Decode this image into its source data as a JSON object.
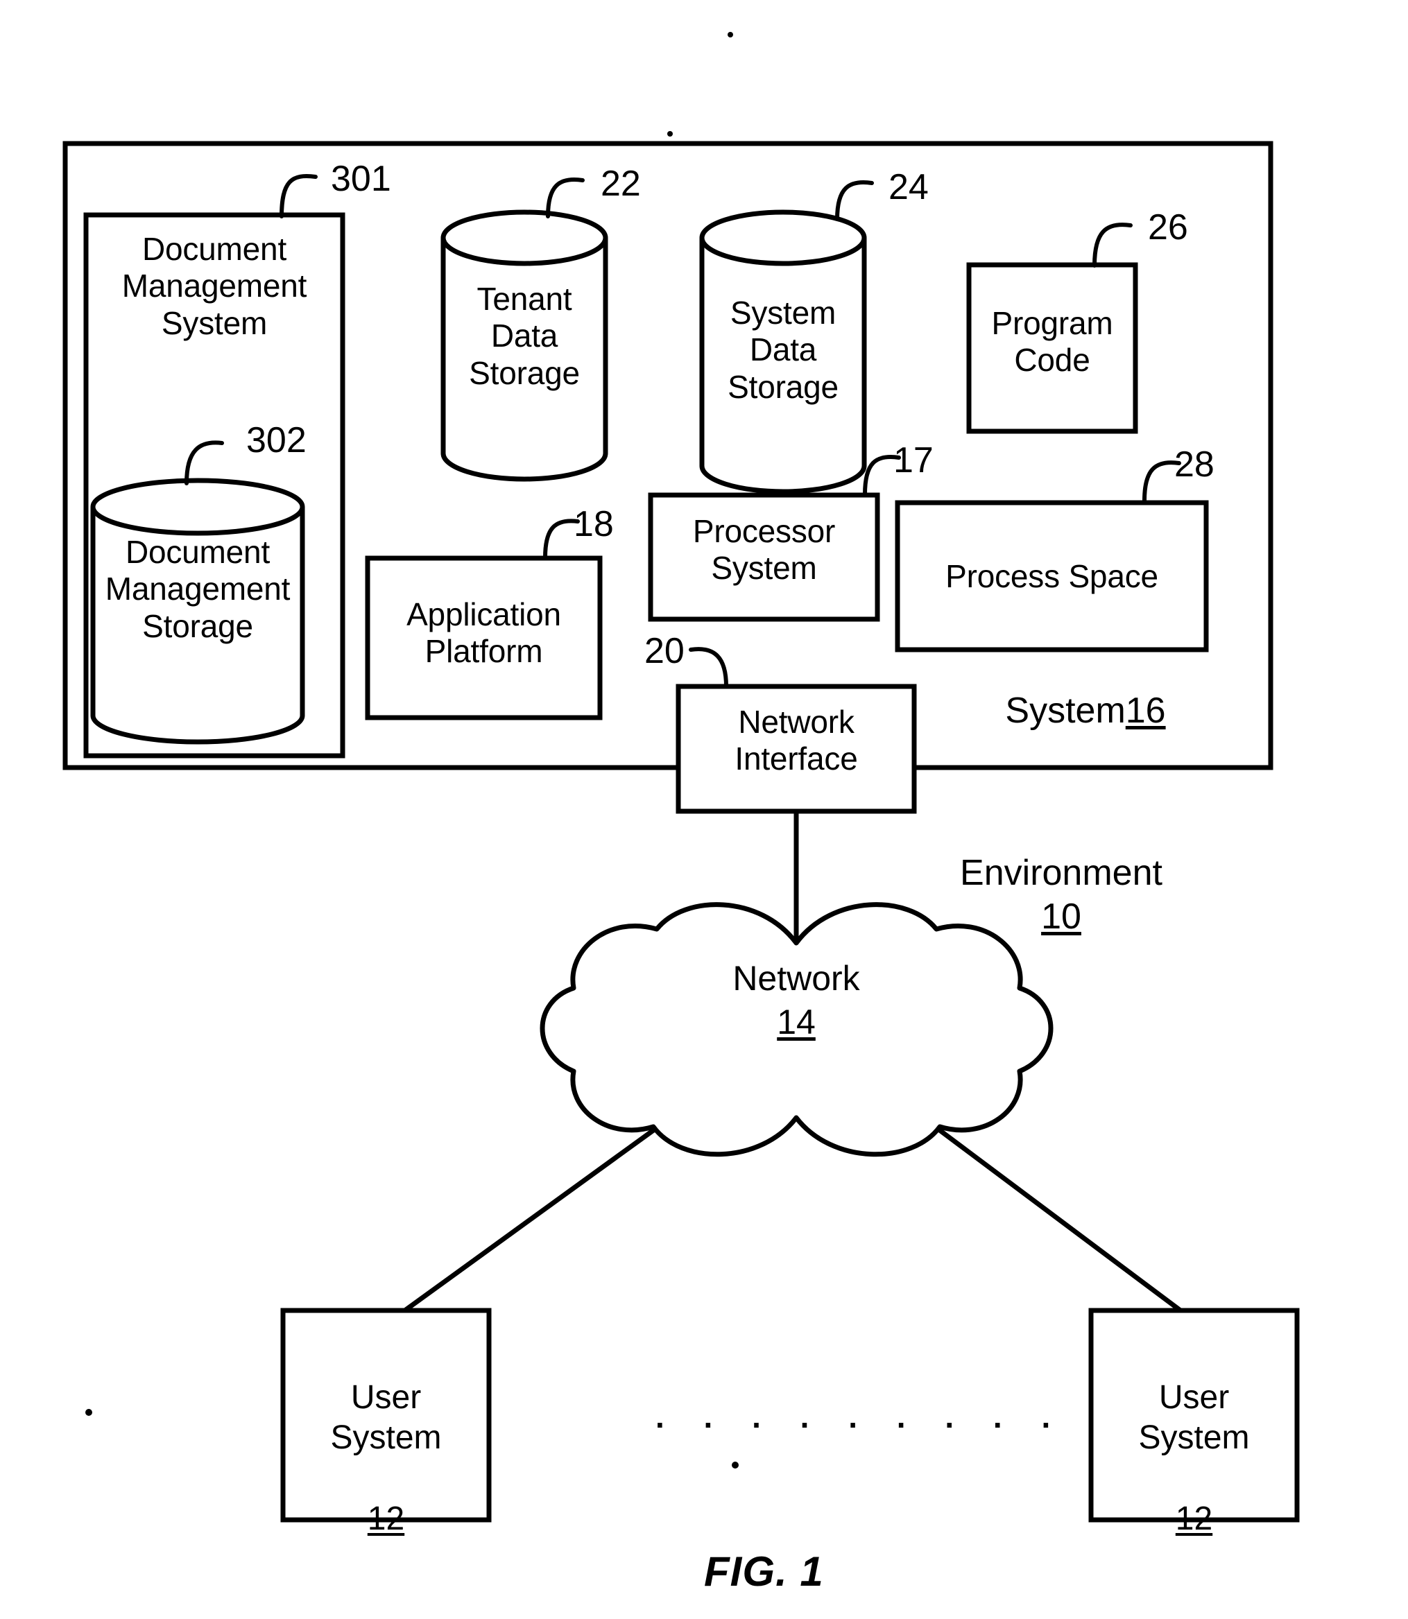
{
  "figure": {
    "caption": "FIG. 1",
    "title": "Environment 10 system block diagram"
  },
  "outer_container": {
    "name": "System",
    "label_text": "System",
    "label_ref": "16"
  },
  "environment": {
    "label_text": "Environment",
    "label_ref": "10"
  },
  "blocks": {
    "document_management_system": {
      "label": "Document\nManagement\nSystem",
      "ref": "301",
      "shape": "rectangle"
    },
    "document_management_storage": {
      "label": "Document\nManagement\nStorage",
      "ref": "302",
      "shape": "cylinder"
    },
    "tenant_data_storage": {
      "label": "Tenant\nData\nStorage",
      "ref": "22",
      "shape": "cylinder"
    },
    "system_data_storage": {
      "label": "System\nData\nStorage",
      "ref": "24",
      "shape": "cylinder"
    },
    "program_code": {
      "label": "Program\nCode",
      "ref": "26",
      "shape": "rectangle"
    },
    "processor_system": {
      "label": "Processor\nSystem",
      "ref": "17",
      "shape": "rectangle"
    },
    "process_space": {
      "label": "Process Space",
      "ref": "28",
      "shape": "rectangle"
    },
    "application_platform": {
      "label": "Application\nPlatform",
      "ref": "18",
      "shape": "rectangle"
    },
    "network_interface": {
      "label": "Network\nInterface",
      "ref": "20",
      "shape": "rectangle"
    },
    "network": {
      "label": "Network",
      "ref": "14",
      "shape": "cloud"
    },
    "user_system_left": {
      "label": "User\nSystem",
      "ref": "12",
      "shape": "rectangle"
    },
    "user_system_right": {
      "label": "User\nSystem",
      "ref": "12",
      "shape": "rectangle"
    }
  },
  "ellipsis": {
    "dots": ". . . . . . . . ."
  },
  "colors": {
    "stroke": "#000000",
    "fill": "#ffffff",
    "background": "#ffffff"
  }
}
